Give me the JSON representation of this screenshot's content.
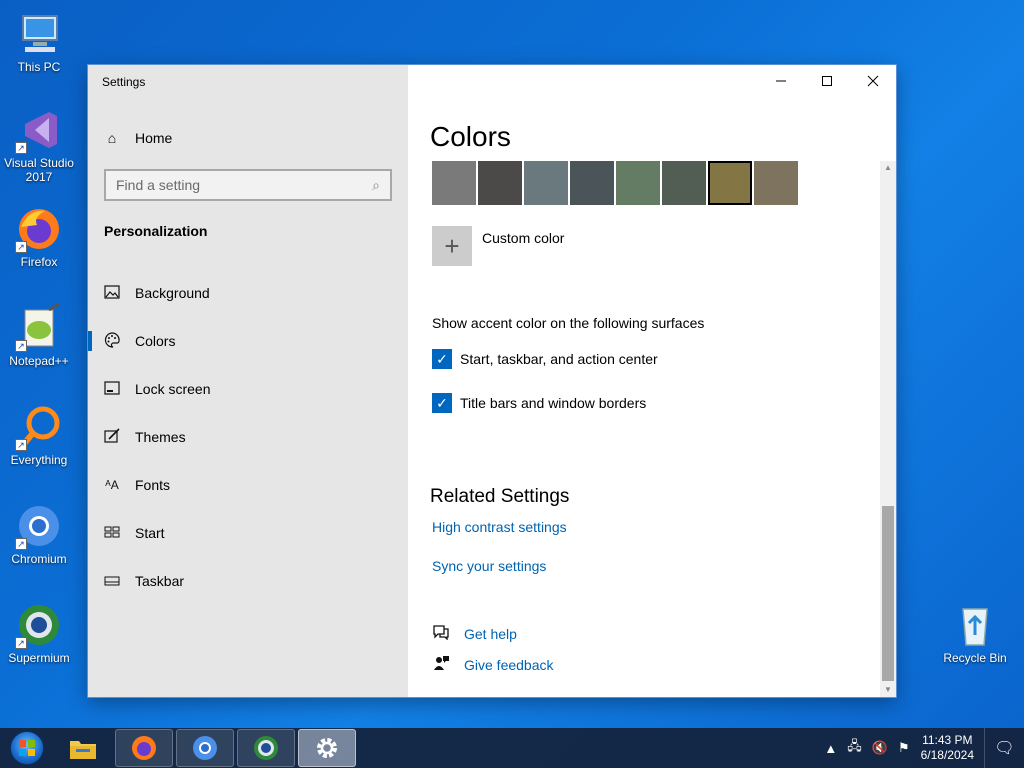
{
  "desktop": {
    "icons": [
      {
        "label": "This PC"
      },
      {
        "label": "Visual Studio 2017"
      },
      {
        "label": "Firefox"
      },
      {
        "label": "Notepad++"
      },
      {
        "label": "Everything"
      },
      {
        "label": "Chromium"
      },
      {
        "label": "Supermium"
      },
      {
        "label": "Recycle Bin"
      }
    ]
  },
  "window": {
    "title": "Settings",
    "caption": {
      "minimize": "—",
      "maximize": "☐",
      "close": "✕"
    }
  },
  "sidebar": {
    "home": "Home",
    "search_placeholder": "Find a setting",
    "section": "Personalization",
    "items": [
      {
        "label": "Background",
        "icon": "image-icon"
      },
      {
        "label": "Colors",
        "icon": "palette-icon",
        "active": true
      },
      {
        "label": "Lock screen",
        "icon": "lock-screen-icon"
      },
      {
        "label": "Themes",
        "icon": "brush-icon"
      },
      {
        "label": "Fonts",
        "icon": "font-icon"
      },
      {
        "label": "Start",
        "icon": "start-icon"
      },
      {
        "label": "Taskbar",
        "icon": "taskbar-icon"
      }
    ]
  },
  "content": {
    "title": "Colors",
    "swatches": [
      "#7a7a7a",
      "#4c4a48",
      "#69797e",
      "#4a5459",
      "#647c64",
      "#525e54",
      "#847545",
      "#7e735f"
    ],
    "selected_swatch_index": 6,
    "custom_color": "Custom color",
    "accent_surfaces_label": "Show accent color on the following surfaces",
    "checkboxes": [
      {
        "label": "Start, taskbar, and action center",
        "checked": true
      },
      {
        "label": "Title bars and window borders",
        "checked": true
      }
    ],
    "related_title": "Related Settings",
    "related_links": [
      "High contrast settings",
      "Sync your settings"
    ],
    "help": [
      {
        "label": "Get help",
        "icon": "help-chat-icon"
      },
      {
        "label": "Give feedback",
        "icon": "feedback-icon"
      }
    ]
  },
  "taskbar": {
    "apps": [
      "file-explorer",
      "firefox",
      "chromium",
      "supermium",
      "settings"
    ],
    "time": "11:43 PM",
    "date": "6/18/2024"
  },
  "colors": {
    "accent": "#0067c0",
    "link": "#0063b1"
  }
}
